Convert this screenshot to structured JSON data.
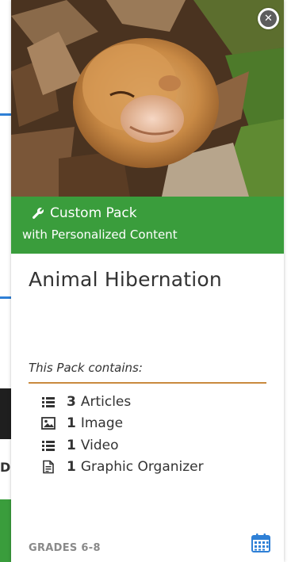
{
  "background": {
    "partial_text": "D"
  },
  "card": {
    "close_label": "✕",
    "banner": {
      "title": "Custom Pack",
      "subtitle": "with Personalized Content"
    },
    "title": "Animal Hibernation",
    "contains_label": "This Pack contains:",
    "items": [
      {
        "icon": "list-icon",
        "count": "3",
        "label": "Articles"
      },
      {
        "icon": "image-icon",
        "count": "1",
        "label": "Image"
      },
      {
        "icon": "list-icon",
        "count": "1",
        "label": "Video"
      },
      {
        "icon": "document-icon",
        "count": "1",
        "label": "Graphic Organizer"
      }
    ],
    "grades": "GRADES 6-8",
    "calendar_icon": "calendar-icon"
  },
  "colors": {
    "banner_green": "#3a9d3c",
    "rule_orange": "#c98a3e",
    "link_blue": "#2f80d6",
    "grades_gray": "#8a8a8a"
  }
}
